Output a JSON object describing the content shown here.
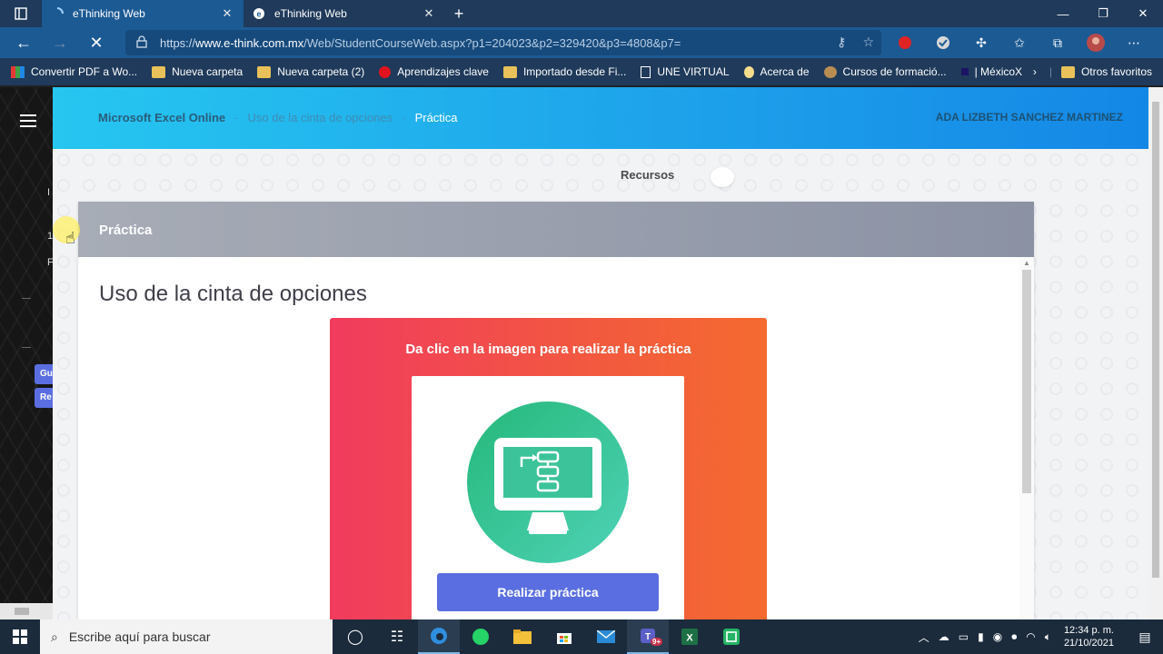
{
  "browser": {
    "tabs": [
      {
        "title": "eThinking Web",
        "active": true
      },
      {
        "title": "eThinking Web",
        "active": false
      }
    ],
    "url_prefix": "https://",
    "url_host": "www.e-think.com.mx",
    "url_path": "/Web/StudentCourseWeb.aspx?p1=204023&p2=329420&p3=4808&p7=",
    "bookmarks": [
      {
        "label": "Convertir PDF a Wo...",
        "icon": "pdf-converter-icon"
      },
      {
        "label": "Nueva carpeta",
        "icon": "folder-icon"
      },
      {
        "label": "Nueva carpeta (2)",
        "icon": "folder-icon"
      },
      {
        "label": "Aprendizajes clave",
        "icon": "red-circle-icon"
      },
      {
        "label": "Importado desde Fi...",
        "icon": "folder-icon"
      },
      {
        "label": "UNE VIRTUAL",
        "icon": "page-icon"
      },
      {
        "label": "Acerca de",
        "icon": "bulb-icon"
      },
      {
        "label": "Cursos de formació...",
        "icon": "brown-circle-icon"
      },
      {
        "label": "| MéxicoX",
        "icon": "mexicox-icon"
      }
    ],
    "other_favorites": "Otros favoritos"
  },
  "sidebar": {
    "menu_icon": "hamburger-icon",
    "fragments": [
      "I",
      "1",
      "F"
    ],
    "pills": [
      "Gu",
      "Re"
    ]
  },
  "header": {
    "breadcrumb": [
      "Microsoft Excel Online",
      "Uso de la cinta de opciones",
      "Práctica"
    ],
    "separator": "-",
    "user": "ADA LIZBETH SANCHEZ MARTINEZ"
  },
  "main": {
    "recursos_label": "Recursos",
    "card_header": "Práctica",
    "title": "Uso de la cinta de opciones",
    "practice_message": "Da clic en la imagen para realizar la práctica",
    "practice_button": "Realizar práctica"
  },
  "taskbar": {
    "search_placeholder": "Escribe aquí para buscar",
    "apps": [
      "task-view-icon",
      "timeline-icon",
      "edge-icon",
      "whatsapp-icon",
      "file-explorer-icon",
      "store-icon",
      "mail-icon",
      "teams-icon",
      "excel-icon",
      "green-app-icon"
    ],
    "teams_badge": "9+",
    "time": "12:34 p. m.",
    "date": "21/10/2021"
  },
  "colors": {
    "header_gradient_start": "#26c6f0",
    "header_gradient_end": "#1487e6",
    "practice_gradient_start": "#f13b5e",
    "practice_gradient_end": "#f46a30",
    "button": "#5b6ee1",
    "circle": "#2fc08a"
  }
}
